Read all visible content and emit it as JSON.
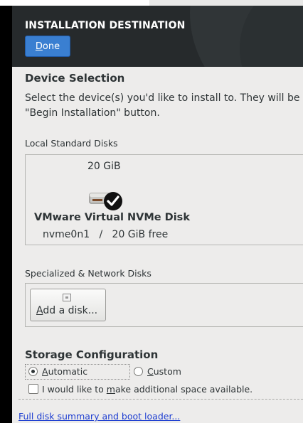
{
  "header": {
    "title": "INSTALLATION DESTINATION",
    "done_label_first": "D",
    "done_label_rest": "one"
  },
  "device_selection": {
    "heading": "Device Selection",
    "description_line1": "Select the device(s) you'd like to install to.  They will be",
    "description_line2": "\"Begin Installation\" button."
  },
  "local_disks": {
    "heading": "Local Standard Disks",
    "disks": [
      {
        "size": "20 GiB",
        "name": "VMware Virtual NVMe Disk",
        "device": "nvme0n1",
        "separator": "/",
        "free": "20 GiB free",
        "selected": true
      }
    ]
  },
  "network_disks": {
    "heading": "Specialized & Network Disks",
    "add_disk_first": "A",
    "add_disk_rest": "dd a disk..."
  },
  "storage": {
    "heading": "Storage Configuration",
    "automatic_first": "A",
    "automatic_rest": "utomatic",
    "custom_first": "C",
    "custom_rest": "ustom",
    "selected": "Automatic",
    "space_label_pre": "I would like to ",
    "space_label_u": "m",
    "space_label_post": "ake additional space available.",
    "space_checked": false
  },
  "footer": {
    "summary_link": "Full disk summary and boot loader..."
  },
  "colors": {
    "accent": "#3a7fd1",
    "link": "#1f3fd1",
    "header_bg": "#262a2c"
  }
}
